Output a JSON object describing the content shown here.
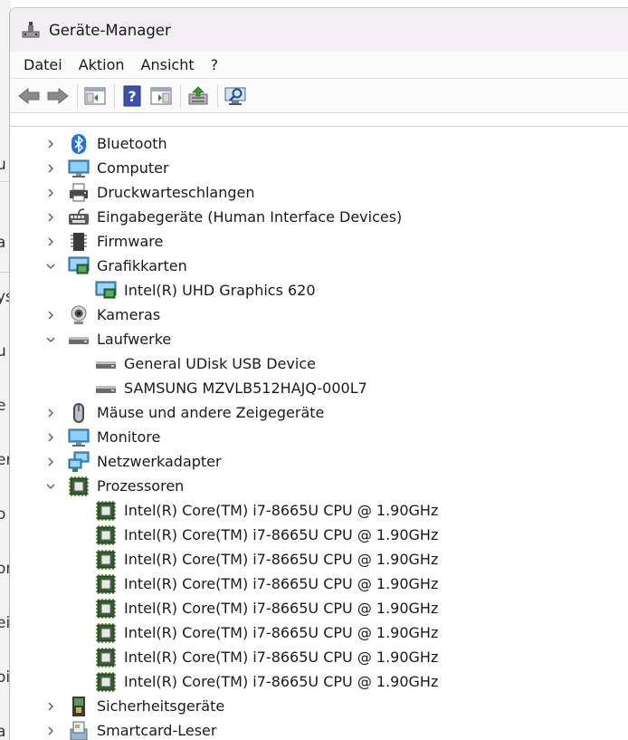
{
  "window": {
    "title": "Geräte-Manager"
  },
  "menu": [
    "Datei",
    "Aktion",
    "Ansicht",
    "?"
  ],
  "background_window": {
    "glyphs": [
      "u",
      "a",
      "ys",
      "u",
      "e",
      "er",
      "o",
      "or",
      "ei",
      "oi",
      "a"
    ]
  },
  "tree": [
    {
      "label": "Bluetooth",
      "icon": "bluetooth-icon",
      "expanded": false,
      "level": 0
    },
    {
      "label": "Computer",
      "icon": "computer-icon",
      "expanded": false,
      "level": 0
    },
    {
      "label": "Druckwarteschlangen",
      "icon": "printer-icon",
      "expanded": false,
      "level": 0
    },
    {
      "label": "Eingabegeräte (Human Interface Devices)",
      "icon": "hid-icon",
      "expanded": false,
      "level": 0
    },
    {
      "label": "Firmware",
      "icon": "firmware-icon",
      "expanded": false,
      "level": 0
    },
    {
      "label": "Grafikkarten",
      "icon": "display-adapter-icon",
      "expanded": true,
      "level": 0
    },
    {
      "label": "Intel(R) UHD Graphics 620",
      "icon": "display-adapter-icon",
      "level": 1
    },
    {
      "label": "Kameras",
      "icon": "camera-icon",
      "expanded": false,
      "level": 0
    },
    {
      "label": "Laufwerke",
      "icon": "drive-icon",
      "expanded": true,
      "level": 0
    },
    {
      "label": "General UDisk USB Device",
      "icon": "drive-icon",
      "level": 1
    },
    {
      "label": "SAMSUNG MZVLB512HAJQ-000L7",
      "icon": "drive-icon",
      "level": 1
    },
    {
      "label": "Mäuse und andere Zeigegeräte",
      "icon": "mouse-icon",
      "expanded": false,
      "level": 0
    },
    {
      "label": "Monitore",
      "icon": "monitor-icon",
      "expanded": false,
      "level": 0
    },
    {
      "label": "Netzwerkadapter",
      "icon": "network-adapter-icon",
      "expanded": false,
      "level": 0
    },
    {
      "label": "Prozessoren",
      "icon": "processor-icon",
      "expanded": true,
      "level": 0
    },
    {
      "label": "Intel(R) Core(TM) i7-8665U CPU @ 1.90GHz",
      "icon": "processor-icon",
      "level": 1
    },
    {
      "label": "Intel(R) Core(TM) i7-8665U CPU @ 1.90GHz",
      "icon": "processor-icon",
      "level": 1
    },
    {
      "label": "Intel(R) Core(TM) i7-8665U CPU @ 1.90GHz",
      "icon": "processor-icon",
      "level": 1
    },
    {
      "label": "Intel(R) Core(TM) i7-8665U CPU @ 1.90GHz",
      "icon": "processor-icon",
      "level": 1
    },
    {
      "label": "Intel(R) Core(TM) i7-8665U CPU @ 1.90GHz",
      "icon": "processor-icon",
      "level": 1
    },
    {
      "label": "Intel(R) Core(TM) i7-8665U CPU @ 1.90GHz",
      "icon": "processor-icon",
      "level": 1
    },
    {
      "label": "Intel(R) Core(TM) i7-8665U CPU @ 1.90GHz",
      "icon": "processor-icon",
      "level": 1
    },
    {
      "label": "Intel(R) Core(TM) i7-8665U CPU @ 1.90GHz",
      "icon": "processor-icon",
      "level": 1
    },
    {
      "label": "Sicherheitsgeräte",
      "icon": "security-device-icon",
      "expanded": false,
      "level": 0
    },
    {
      "label": "Smartcard-Leser",
      "icon": "smartcard-reader-icon",
      "expanded": false,
      "level": 0
    }
  ],
  "toolbar": [
    "back-icon",
    "forward-icon",
    "show-hide-console-tree-icon",
    "help-icon",
    "properties-icon",
    "update-driver-icon",
    "scan-hardware-icon"
  ],
  "colors": {
    "titlebar": "#f3edf4",
    "accent": "#1a73e8",
    "chip": "#2f6b2f"
  }
}
